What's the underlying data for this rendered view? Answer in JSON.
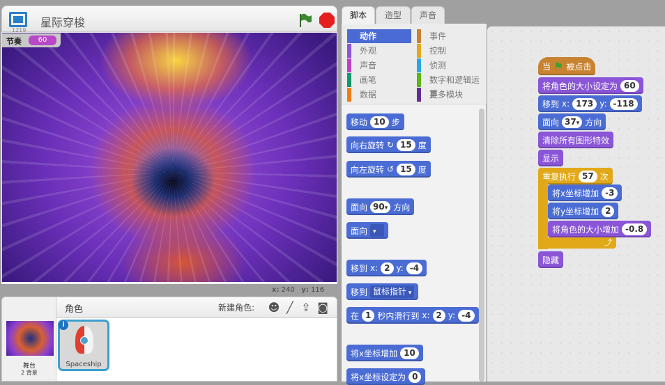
{
  "stage": {
    "version": "1219",
    "title": "星际穿梭",
    "tempo_label": "节奏",
    "tempo_value": "60",
    "coord_x_label": "x:",
    "coord_x": "240",
    "coord_y_label": "y:",
    "coord_y": "116",
    "flag_color": "#3a8a2e",
    "stop_color": "#e51e1e"
  },
  "sprites": {
    "title": "角色",
    "new_sprite_label": "新建角色:",
    "stage_label": "舞台",
    "stage_backdrops": "2 背景",
    "sprite_name": "Spaceship",
    "info": "i",
    "new_icons": [
      "sprite-library-icon",
      "paint-brush-icon",
      "upload-icon",
      "camera-icon"
    ]
  },
  "tabs": [
    {
      "label": "脚本"
    },
    {
      "label": "造型"
    },
    {
      "label": "声音"
    }
  ],
  "categories": [
    {
      "label": "动作",
      "color": "#4a6cd4"
    },
    {
      "label": "外观",
      "color": "#8a55d7"
    },
    {
      "label": "声音",
      "color": "#bb42c3"
    },
    {
      "label": "画笔",
      "color": "#0e9a6c"
    },
    {
      "label": "数据",
      "color": "#ee7d16"
    },
    {
      "label": "事件",
      "color": "#c88330"
    },
    {
      "label": "控制",
      "color": "#e1a91a"
    },
    {
      "label": "侦测",
      "color": "#2ca5e2"
    },
    {
      "label": "数字和逻辑运算",
      "color": "#5cb712"
    },
    {
      "label": "更多模块",
      "color": "#632d99"
    }
  ],
  "palette": [
    [
      {
        "t": "移动"
      },
      {
        "n": "10"
      },
      {
        "t": "步"
      }
    ],
    [
      {
        "t": "向右旋转"
      },
      {
        "t": "↻"
      },
      {
        "n": "15"
      },
      {
        "t": "度"
      }
    ],
    [
      {
        "t": "向左旋转"
      },
      {
        "t": "↺"
      },
      {
        "n": "15"
      },
      {
        "t": "度"
      }
    ],
    [
      {
        "t": "面向"
      },
      {
        "d": "90"
      },
      {
        "t": "方向"
      }
    ],
    [
      {
        "t": "面向"
      },
      {
        "b": ""
      }
    ],
    [
      {
        "t": "移到"
      },
      {
        "t": "x:"
      },
      {
        "n": "2"
      },
      {
        "t": "y:"
      },
      {
        "n": "-4"
      }
    ],
    [
      {
        "t": "移到"
      },
      {
        "b": "鼠标指针"
      }
    ],
    [
      {
        "t": "在"
      },
      {
        "n": "1"
      },
      {
        "t": "秒内滑行到"
      },
      {
        "t": "x:"
      },
      {
        "n": "2"
      },
      {
        "t": "y:"
      },
      {
        "n": "-4"
      }
    ],
    [
      {
        "t": "将x坐标增加"
      },
      {
        "n": "10"
      }
    ],
    [
      {
        "t": "将x坐标设定为"
      },
      {
        "n": "0"
      }
    ]
  ],
  "script": [
    {
      "cat": "events",
      "parts": [
        {
          "t": "当"
        },
        {
          "f": "green-flag"
        },
        {
          "t": "被点击"
        }
      ]
    },
    {
      "cat": "looks",
      "parts": [
        {
          "t": "将角色的大小设定为"
        },
        {
          "n": "60"
        }
      ]
    },
    {
      "cat": "motion",
      "parts": [
        {
          "t": "移到"
        },
        {
          "t": "x:"
        },
        {
          "n": "173"
        },
        {
          "t": "y:"
        },
        {
          "n": "-118"
        }
      ]
    },
    {
      "cat": "motion",
      "parts": [
        {
          "t": "面向"
        },
        {
          "d": "37"
        },
        {
          "t": "方向"
        }
      ]
    },
    {
      "cat": "looks",
      "parts": [
        {
          "t": "清除所有图形特效"
        }
      ]
    },
    {
      "cat": "looks",
      "parts": [
        {
          "t": "显示"
        }
      ]
    },
    {
      "cat": "control",
      "parts": [
        {
          "t": "重复执行"
        },
        {
          "n": "57"
        },
        {
          "t": "次"
        }
      ]
    },
    {
      "cat": "motion",
      "parts": [
        {
          "t": "将x坐标增加"
        },
        {
          "n": "-3"
        }
      ]
    },
    {
      "cat": "motion",
      "parts": [
        {
          "t": "将y坐标增加"
        },
        {
          "n": "2"
        }
      ]
    },
    {
      "cat": "looks",
      "parts": [
        {
          "t": "将角色的大小增加"
        },
        {
          "n": "-0.8"
        }
      ]
    },
    {
      "cat": "looks",
      "parts": [
        {
          "t": "隐藏"
        }
      ]
    }
  ]
}
